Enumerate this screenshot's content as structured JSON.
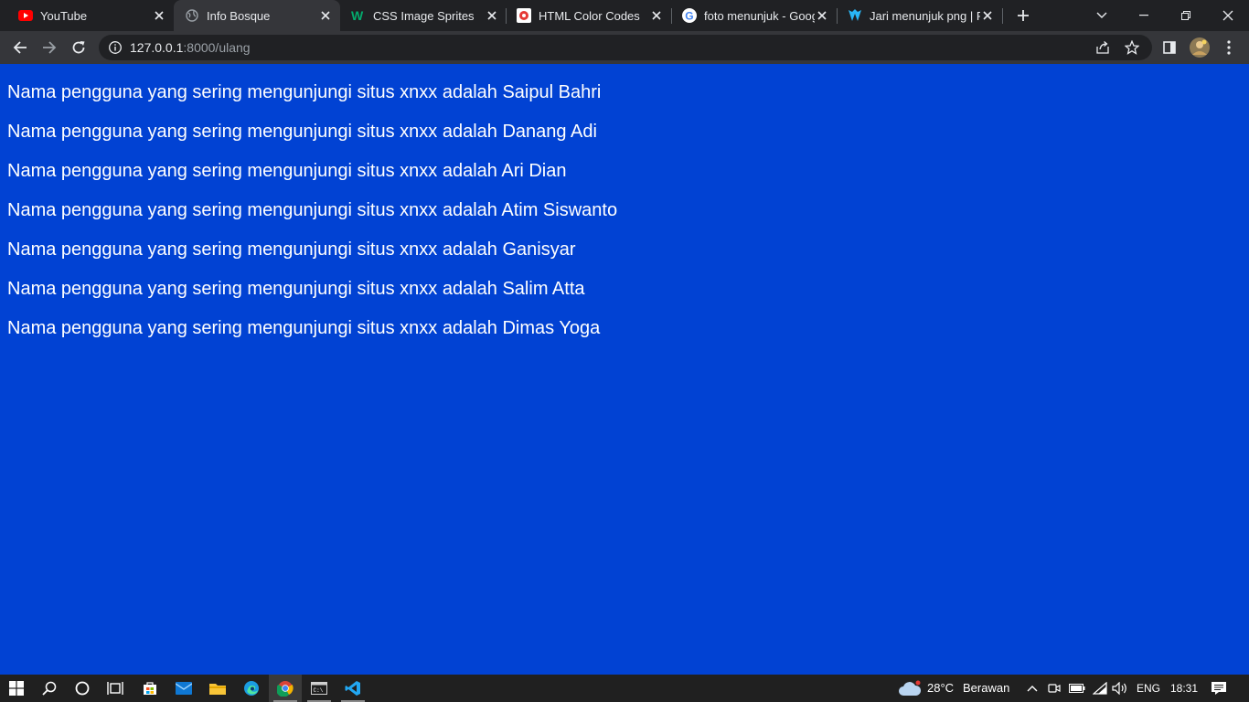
{
  "browser": {
    "tabs": [
      {
        "title": "YouTube",
        "icon": "youtube-icon"
      },
      {
        "title": "Info Bosque",
        "icon": "globe-icon",
        "active": true
      },
      {
        "title": "CSS Image Sprites",
        "icon": "w3schools-icon"
      },
      {
        "title": "HTML Color Codes",
        "icon": "color-codes-icon"
      },
      {
        "title": "foto menunjuk - Goog",
        "icon": "google-icon"
      },
      {
        "title": "Jari menunjuk png | Pl",
        "icon": "pngtree-icon"
      }
    ],
    "new_tab_icon": "plus-icon",
    "address": {
      "host": "127.0.0.1",
      "path": ":8000/ulang"
    }
  },
  "page": {
    "lines": [
      "Nama pengguna yang sering mengunjungi situs xnxx adalah Saipul Bahri",
      "Nama pengguna yang sering mengunjungi situs xnxx adalah Danang Adi",
      "Nama pengguna yang sering mengunjungi situs xnxx adalah Ari Dian",
      "Nama pengguna yang sering mengunjungi situs xnxx adalah Atim Siswanto",
      "Nama pengguna yang sering mengunjungi situs xnxx adalah Ganisyar",
      "Nama pengguna yang sering mengunjungi situs xnxx adalah Salim Atta",
      "Nama pengguna yang sering mengunjungi situs xnxx adalah Dimas Yoga"
    ],
    "background_color": "#0142d3",
    "text_color": "#ffffff"
  },
  "taskbar": {
    "weather": {
      "temp": "28°C",
      "condition": "Berawan"
    },
    "language": "ENG",
    "time": "18:31"
  }
}
